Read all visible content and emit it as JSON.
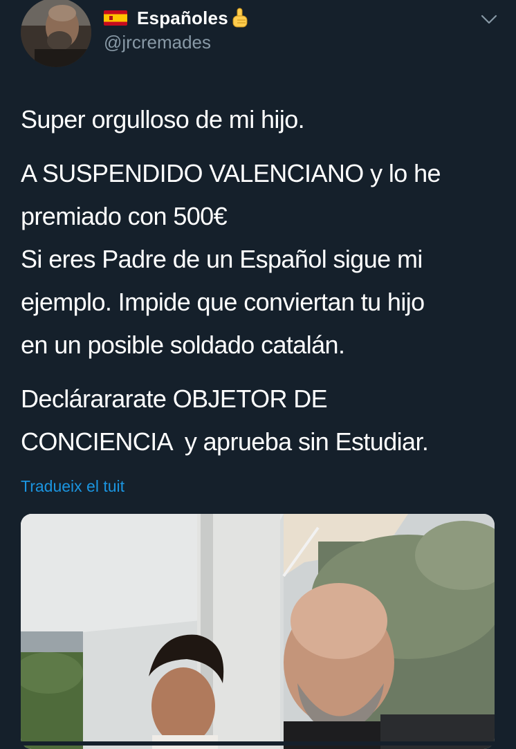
{
  "tweet": {
    "author": {
      "display_name": "Españoles",
      "flag_icon": "spain-flag-icon",
      "emoji_icon": "pointing-up-finger-icon",
      "handle": "@jrcremades"
    },
    "menu_icon": "chevron-down-icon",
    "text": {
      "line1": "Super orgulloso de mi hijo.",
      "para2": "A SUSPENDIDO VALENCIANO y lo he\npremiado con 500€\nSi eres Padre de un Español sigue mi\nejemplo. Impide que conviertan tu hijo\nen un posible soldado catalán.",
      "para3": "Declárararate OBJETOR DE\nCONCIENCIA  y aprueba sin Estudiar."
    },
    "translate_label": "Tradueix el tuit",
    "media": {
      "type": "photo"
    }
  },
  "colors": {
    "background": "#15202b",
    "text": "#ffffff",
    "secondary_text": "#8899a6",
    "link": "#1b95e0"
  }
}
